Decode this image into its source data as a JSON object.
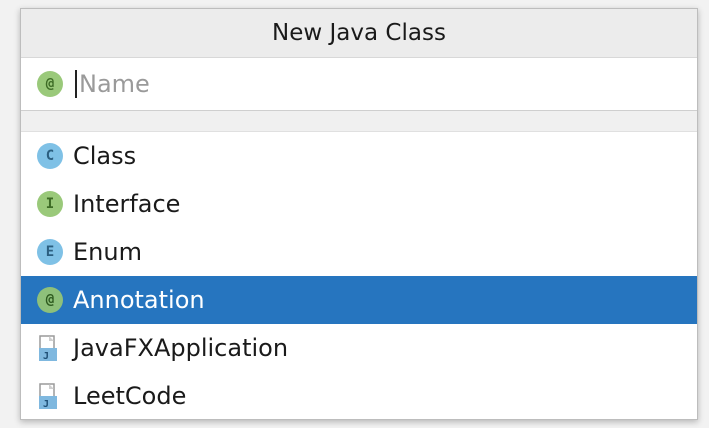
{
  "dialog": {
    "title": "New Java Class",
    "name_placeholder": "Name",
    "name_value": "",
    "name_icon": "annotation-icon"
  },
  "items": [
    {
      "label": "Class",
      "icon": "class-icon",
      "letter": "C",
      "selected": false
    },
    {
      "label": "Interface",
      "icon": "interface-icon",
      "letter": "I",
      "selected": false
    },
    {
      "label": "Enum",
      "icon": "enum-icon",
      "letter": "E",
      "selected": false
    },
    {
      "label": "Annotation",
      "icon": "annotation-icon",
      "letter": "@",
      "selected": true
    },
    {
      "label": "JavaFXApplication",
      "icon": "template-file-icon",
      "letter": "J",
      "selected": false
    },
    {
      "label": "LeetCode",
      "icon": "template-file-icon",
      "letter": "J",
      "selected": false
    }
  ],
  "colors": {
    "selection": "#2675bf",
    "header_bg": "#ececec"
  }
}
